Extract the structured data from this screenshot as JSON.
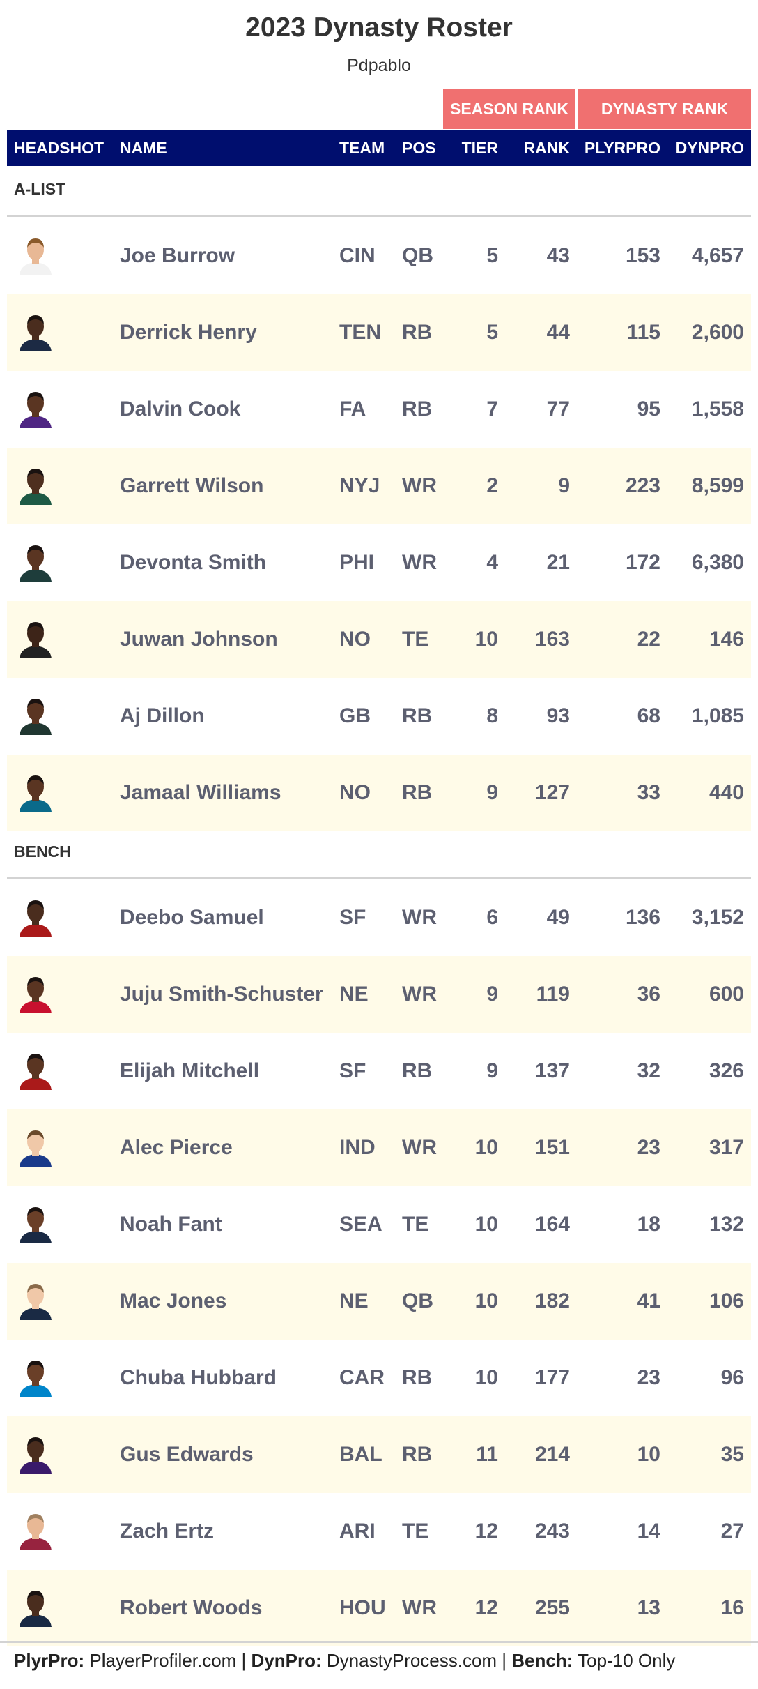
{
  "title": "2023 Dynasty Roster",
  "subtitle": "Pdpablo",
  "spanners": {
    "season": "SEASON RANK",
    "dynasty": "DYNASTY RANK"
  },
  "columns": {
    "headshot": "HEADSHOT",
    "name": "NAME",
    "team": "TEAM",
    "pos": "POS",
    "tier": "TIER",
    "rank": "RANK",
    "plyrpro": "PLYRPRO",
    "dynpro": "DYNPRO"
  },
  "colors": {
    "header_bg": "#000e6e",
    "spanner_bg": "#f07070",
    "shade": "#fffbe8",
    "text": "#5c5f70"
  },
  "groups": [
    {
      "label": "A-LIST",
      "rows": [
        {
          "name": "Joe Burrow",
          "team": "CIN",
          "pos": "QB",
          "tier": "5",
          "rank": "43",
          "plyrpro": "153",
          "dynpro": "4,657",
          "skin": "#e8b895",
          "jersey": "#f2f2f2",
          "hair": "#8a5a2b"
        },
        {
          "name": "Derrick Henry",
          "team": "TEN",
          "pos": "RB",
          "tier": "5",
          "rank": "44",
          "plyrpro": "115",
          "dynpro": "2,600",
          "skin": "#4a2d1e",
          "jersey": "#1c2a44",
          "hair": "#1a1210"
        },
        {
          "name": "Dalvin Cook",
          "team": "FA",
          "pos": "RB",
          "tier": "7",
          "rank": "77",
          "plyrpro": "95",
          "dynpro": "1,558",
          "skin": "#5a3522",
          "jersey": "#4f2683",
          "hair": "#1a1210"
        },
        {
          "name": "Garrett Wilson",
          "team": "NYJ",
          "pos": "WR",
          "tier": "2",
          "rank": "9",
          "plyrpro": "223",
          "dynpro": "8,599",
          "skin": "#4e2f1f",
          "jersey": "#1e5a45",
          "hair": "#1a1210"
        },
        {
          "name": "Devonta Smith",
          "team": "PHI",
          "pos": "WR",
          "tier": "4",
          "rank": "21",
          "plyrpro": "172",
          "dynpro": "6,380",
          "skin": "#5a3522",
          "jersey": "#1e3d3b",
          "hair": "#1a1210"
        },
        {
          "name": "Juwan Johnson",
          "team": "NO",
          "pos": "TE",
          "tier": "10",
          "rank": "163",
          "plyrpro": "22",
          "dynpro": "146",
          "skin": "#3d2418",
          "jersey": "#222222",
          "hair": "#1a1210"
        },
        {
          "name": "Aj Dillon",
          "team": "GB",
          "pos": "RB",
          "tier": "8",
          "rank": "93",
          "plyrpro": "68",
          "dynpro": "1,085",
          "skin": "#5a3522",
          "jersey": "#203731",
          "hair": "#1a1210"
        },
        {
          "name": "Jamaal Williams",
          "team": "NO",
          "pos": "RB",
          "tier": "9",
          "rank": "127",
          "plyrpro": "33",
          "dynpro": "440",
          "skin": "#5a3522",
          "jersey": "#0a6a8a",
          "hair": "#1a1210"
        }
      ]
    },
    {
      "label": "BENCH",
      "rows": [
        {
          "name": "Deebo Samuel",
          "team": "SF",
          "pos": "WR",
          "tier": "6",
          "rank": "49",
          "plyrpro": "136",
          "dynpro": "3,152",
          "skin": "#4a2d1e",
          "jersey": "#aa1a1a",
          "hair": "#1a1210"
        },
        {
          "name": "Juju Smith-Schuster",
          "team": "NE",
          "pos": "WR",
          "tier": "9",
          "rank": "119",
          "plyrpro": "36",
          "dynpro": "600",
          "skin": "#5a3522",
          "jersey": "#c8102e",
          "hair": "#1a1210"
        },
        {
          "name": "Elijah Mitchell",
          "team": "SF",
          "pos": "RB",
          "tier": "9",
          "rank": "137",
          "plyrpro": "32",
          "dynpro": "326",
          "skin": "#5a3522",
          "jersey": "#aa1a1a",
          "hair": "#1a1210"
        },
        {
          "name": "Alec Pierce",
          "team": "IND",
          "pos": "WR",
          "tier": "10",
          "rank": "151",
          "plyrpro": "23",
          "dynpro": "317",
          "skin": "#f0c8a8",
          "jersey": "#1a3a8a",
          "hair": "#6b4a2b"
        },
        {
          "name": "Noah Fant",
          "team": "SEA",
          "pos": "TE",
          "tier": "10",
          "rank": "164",
          "plyrpro": "18",
          "dynpro": "132",
          "skin": "#6a3f28",
          "jersey": "#1a2a44",
          "hair": "#1a1210"
        },
        {
          "name": "Mac Jones",
          "team": "NE",
          "pos": "QB",
          "tier": "10",
          "rank": "182",
          "plyrpro": "41",
          "dynpro": "106",
          "skin": "#f0c8a8",
          "jersey": "#1a2a44",
          "hair": "#8a6a4a"
        },
        {
          "name": "Chuba Hubbard",
          "team": "CAR",
          "pos": "RB",
          "tier": "10",
          "rank": "177",
          "plyrpro": "23",
          "dynpro": "96",
          "skin": "#6a3f28",
          "jersey": "#0085ca",
          "hair": "#1a1210"
        },
        {
          "name": "Gus Edwards",
          "team": "BAL",
          "pos": "RB",
          "tier": "11",
          "rank": "214",
          "plyrpro": "10",
          "dynpro": "35",
          "skin": "#4a2d1e",
          "jersey": "#3a1a6a",
          "hair": "#1a1210"
        },
        {
          "name": "Zach Ertz",
          "team": "ARI",
          "pos": "TE",
          "tier": "12",
          "rank": "243",
          "plyrpro": "14",
          "dynpro": "27",
          "skin": "#e8b895",
          "jersey": "#97233f",
          "hair": "#a08060"
        },
        {
          "name": "Robert Woods",
          "team": "HOU",
          "pos": "WR",
          "tier": "12",
          "rank": "255",
          "plyrpro": "13",
          "dynpro": "16",
          "skin": "#4a2d1e",
          "jersey": "#1a2a44",
          "hair": "#1a1210"
        }
      ]
    }
  ],
  "footnote": {
    "plyr_label": "PlyrPro:",
    "plyr_text": " PlayerProfiler.com | ",
    "dyn_label": "DynPro:",
    "dyn_text": " DynastyProcess.com | ",
    "bench_label": "Bench:",
    "bench_text": " Top-10 Only"
  }
}
